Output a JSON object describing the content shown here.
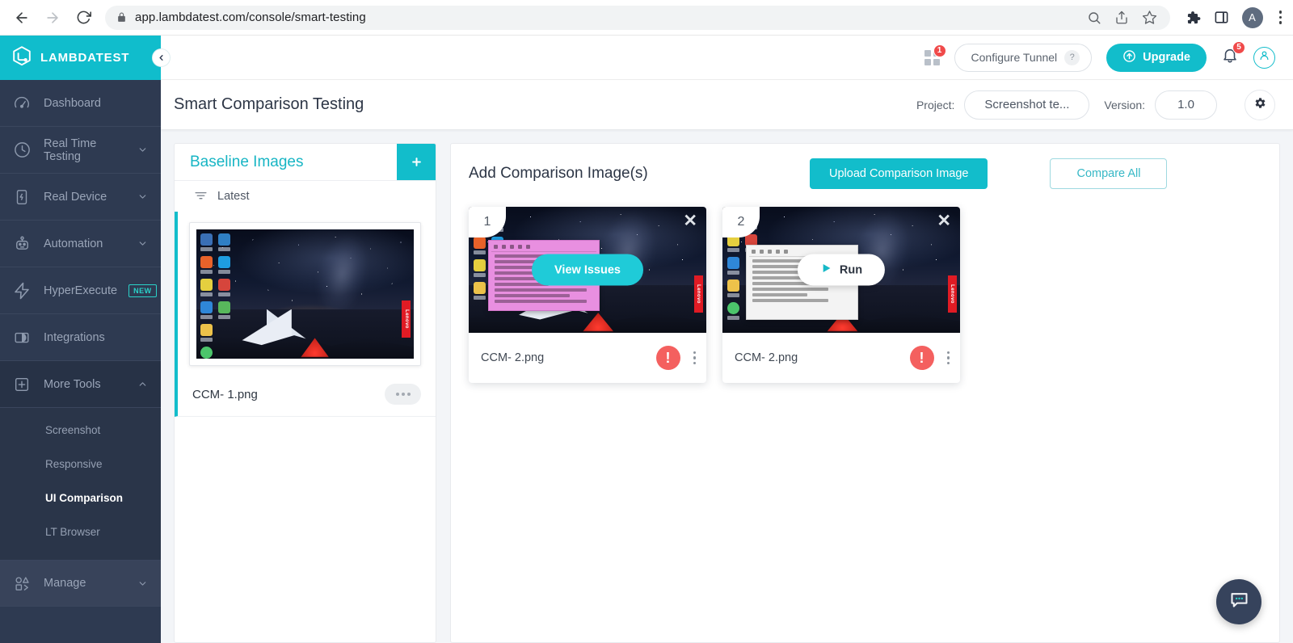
{
  "browser": {
    "url": "app.lambdatest.com/console/smart-testing",
    "back_icon": "back-arrow-icon",
    "forward_icon": "forward-arrow-icon",
    "reload_icon": "reload-icon",
    "lock_icon": "lock-icon",
    "zoom_out_icon": "zoom-out-icon",
    "share_icon": "share-icon",
    "bookmark_icon": "star-icon",
    "extensions_icon": "puzzle-icon",
    "sidepanel_icon": "side-panel-icon",
    "profile_initial": "A",
    "menu_icon": "three-dot-menu-icon"
  },
  "sidebar": {
    "brand": "LAMBDATEST",
    "collapse_icon": "chevron-left-icon",
    "items": [
      {
        "label": "Dashboard",
        "icon": "speedometer-icon",
        "chevron": false
      },
      {
        "label": "Real Time Testing",
        "icon": "clock-icon",
        "chevron": true
      },
      {
        "label": "Real Device",
        "icon": "mobile-device-icon",
        "chevron": true
      },
      {
        "label": "Automation",
        "icon": "robot-icon",
        "chevron": true
      },
      {
        "label": "HyperExecute",
        "icon": "lightning-bolt-icon",
        "chevron": false,
        "badge": "NEW"
      },
      {
        "label": "Integrations",
        "icon": "integrations-icon",
        "chevron": false
      },
      {
        "label": "More Tools",
        "icon": "plus-square-icon",
        "chevron": true,
        "expanded": true
      }
    ],
    "sub_items": [
      {
        "label": "Screenshot",
        "active": false
      },
      {
        "label": "Responsive",
        "active": false
      },
      {
        "label": "UI Comparison",
        "active": true
      },
      {
        "label": "LT Browser",
        "active": false
      }
    ],
    "manage": {
      "label": "Manage",
      "icon": "shapes-icon",
      "chevron": true
    }
  },
  "topbar": {
    "grid_icon": "app-grid-icon",
    "grid_badge": "1",
    "configure_tunnel": "Configure Tunnel",
    "help_icon": "question-mark-icon",
    "upgrade": "Upgrade",
    "upgrade_icon": "upload-circle-icon",
    "bell_icon": "bell-icon",
    "bell_badge": "5",
    "user_icon": "user-avatar-icon"
  },
  "pagebar": {
    "title": "Smart Comparison Testing",
    "project_label": "Project:",
    "project_value": "Screenshot te...",
    "version_label": "Version:",
    "version_value": "1.0",
    "settings_icon": "gear-icon"
  },
  "baseline": {
    "title": "Baseline Images",
    "add_icon": "plus-icon",
    "filter_icon": "filter-sort-icon",
    "filter_label": "Latest",
    "items": [
      {
        "name": "CCM- 1.png",
        "more_icon": "more-options-icon"
      }
    ]
  },
  "comparison": {
    "title": "Add Comparison Image(s)",
    "upload_button": "Upload Comparison Image",
    "compare_all_button": "Compare All",
    "cards": [
      {
        "number": "1",
        "name": "CCM- 2.png",
        "action_label": "View Issues",
        "action_type": "issues",
        "close_icon": "close-x-icon",
        "status_icon": "error-exclamation-icon",
        "menu_icon": "vertical-dots-icon"
      },
      {
        "number": "2",
        "name": "CCM- 2.png",
        "action_label": "Run",
        "action_type": "run",
        "play_icon": "play-triangle-icon",
        "close_icon": "close-x-icon",
        "status_icon": "error-exclamation-icon",
        "menu_icon": "vertical-dots-icon"
      }
    ]
  },
  "chat": {
    "icon": "chat-bubble-icon"
  },
  "colors": {
    "brand_teal": "#12bdcb",
    "sidebar_navy": "#2e3a51",
    "error_red": "#f4605f",
    "badge_red": "#f04a4a"
  }
}
